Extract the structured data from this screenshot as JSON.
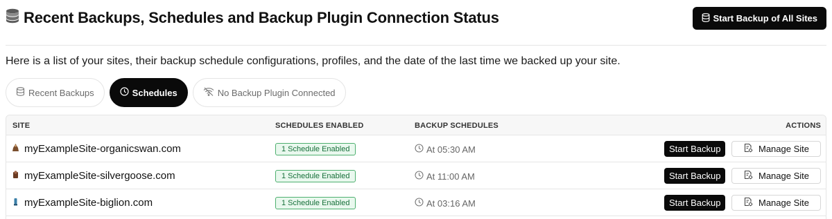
{
  "header": {
    "title": "Recent Backups, Schedules and Backup Plugin Connection Status",
    "title_icon": "database-icon",
    "start_all_label": "Start Backup of All Sites",
    "start_all_icon": "database-icon"
  },
  "description": "Here is a list of your sites, their backup schedule configurations, profiles, and the date of the last time we backed up your site.",
  "tabs": [
    {
      "label": "Recent Backups",
      "icon": "database-icon",
      "active": false
    },
    {
      "label": "Schedules",
      "icon": "clock-icon",
      "active": true
    },
    {
      "label": "No Backup Plugin Connected",
      "icon": "wifi-off-icon",
      "active": false
    }
  ],
  "table": {
    "headers": {
      "site": "SITE",
      "schedules_enabled": "SCHEDULES ENABLED",
      "backup_schedules": "BACKUP SCHEDULES",
      "actions": "ACTIONS"
    },
    "rows": [
      {
        "site": "myExampleSite-organicswan.com",
        "favicon_color": "#7a4e2d",
        "schedules_enabled": "1 Schedule Enabled",
        "schedule_time": "At 05:30 AM",
        "start_label": "Start Backup",
        "manage_label": "Manage Site"
      },
      {
        "site": "myExampleSite-silvergoose.com",
        "favicon_color": "#6b3b22",
        "schedules_enabled": "1 Schedule Enabled",
        "schedule_time": "At 11:00 AM",
        "start_label": "Start Backup",
        "manage_label": "Manage Site"
      },
      {
        "site": "myExampleSite-biglion.com",
        "favicon_color": "#3a7fa8",
        "schedules_enabled": "1 Schedule Enabled",
        "schedule_time": "At 03:16 AM",
        "start_label": "Start Backup",
        "manage_label": "Manage Site"
      }
    ]
  },
  "colors": {
    "primary_button": "#0a0a0a",
    "badge_bg": "#e9f8ee",
    "badge_border": "#4caf6e",
    "badge_text": "#17703a"
  }
}
